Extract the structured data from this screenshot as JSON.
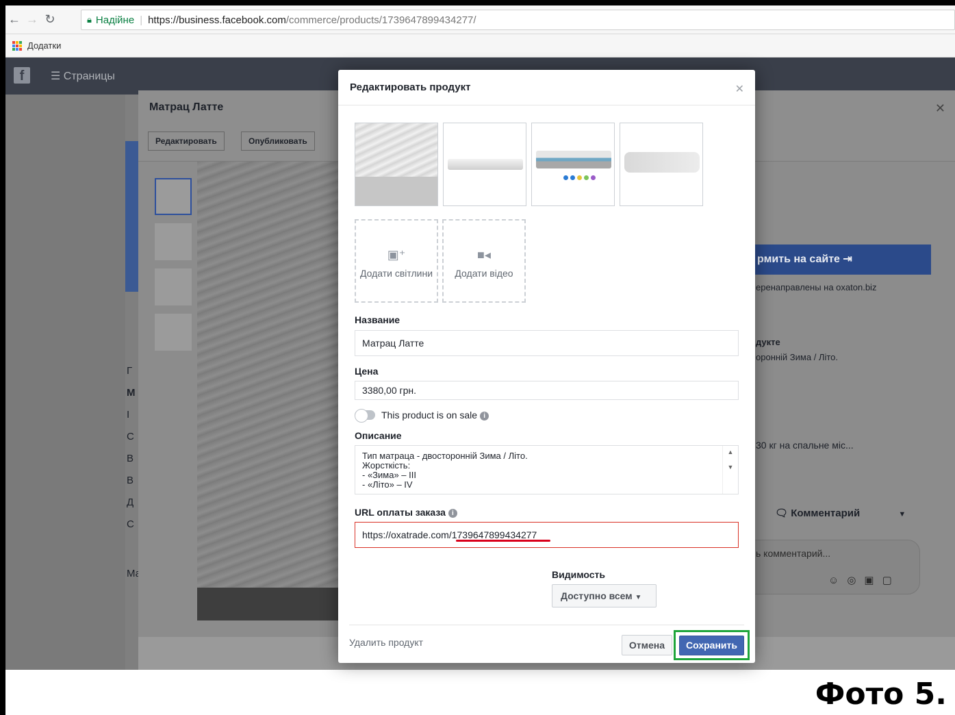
{
  "browser": {
    "secure_label": "Надійне",
    "url_host": "https://business.facebook.com",
    "url_path": "/commerce/products/1739647899434277/",
    "bookmarks_label": "Додатки"
  },
  "fb": {
    "logo": "f",
    "pages_label": "Страницы"
  },
  "bg_dialog": {
    "title": "Матрац Латте",
    "edit_label": "Редактировать",
    "publish_label": "Опубликовать",
    "buy_label": "рмить на сайте",
    "redirect_text": "еренаправлены на oxaton.biz",
    "about_heading": "дукте",
    "about_text": "оронній Зима / Літо.",
    "weight_text": "30 кг на спальне міс...",
    "comment_label": "Комментарий",
    "comment_placeholder": "ь комментарий...",
    "left_letters": [
      "Г",
      "М",
      "І",
      "С",
      "В",
      "В",
      "Д",
      "С"
    ],
    "left_bottom": "Ма"
  },
  "modal": {
    "title": "Редактировать продукт",
    "add_photos_label": "Додати світлини",
    "add_video_label": "Додати відео",
    "name_label": "Название",
    "name_value": "Матрац Латте",
    "price_label": "Цена",
    "price_value": "3380,00 грн.",
    "sale_label": "This product is on sale",
    "description_label": "Описание",
    "description_value": "Тип матраца - двосторонній Зима / Літо.\nЖорсткість:\n- «Зима» – III\n- «Літо» – IV",
    "url_label": "URL оплаты заказа",
    "url_value": "https://oxatrade.com/1739647899434277",
    "visibility_label": "Видимость",
    "visibility_value": "Доступно всем",
    "delete_label": "Удалить продукт",
    "cancel_label": "Отмена",
    "save_label": "Сохранить"
  },
  "caption": "Фото 5."
}
